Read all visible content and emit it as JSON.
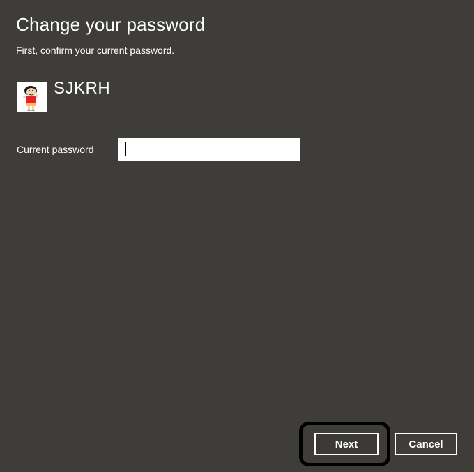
{
  "dialog": {
    "title": "Change your password",
    "subtitle": "First, confirm your current password."
  },
  "account": {
    "username": "SJKRH",
    "avatar_icon": "cartoon-character-avatar-icon"
  },
  "form": {
    "current_password_label": "Current password",
    "current_password_value": ""
  },
  "buttons": {
    "next_label": "Next",
    "cancel_label": "Cancel"
  },
  "colors": {
    "background": "#3e3d39",
    "text": "#ffffff",
    "input_bg": "#ffffff",
    "highlight": "#000000"
  }
}
